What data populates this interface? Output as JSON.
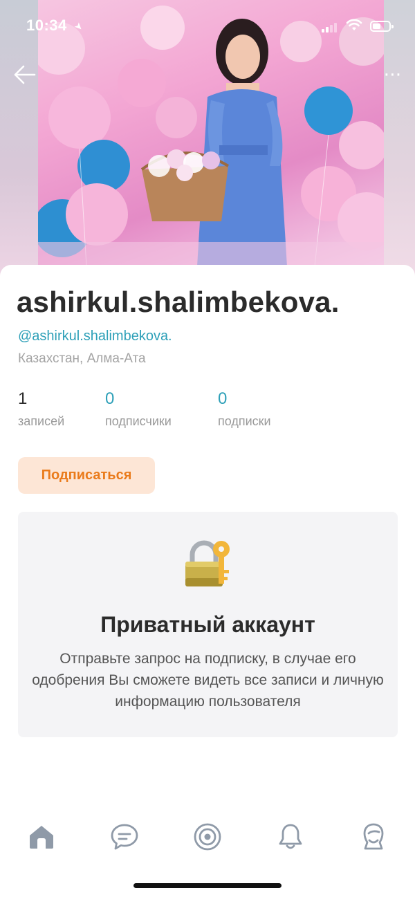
{
  "status_bar": {
    "time": "10:34"
  },
  "profile": {
    "username": "ashirkul.shalimbekova.",
    "handle": "@ashirkul.shalimbekova.",
    "location": "Казахстан, Алма-Ата",
    "stats": {
      "posts": {
        "value": "1",
        "label": "записей"
      },
      "followers": {
        "value": "0",
        "label": "подписчики"
      },
      "following": {
        "value": "0",
        "label": "подписки"
      }
    },
    "follow_label": "Подписаться"
  },
  "private_notice": {
    "title": "Приватный аккаунт",
    "description": "Отправьте запрос на подписку, в случае его одобрения Вы сможете видеть все записи и личную информацию пользователя"
  },
  "tabbar": {
    "items": [
      "home-icon",
      "chat-icon",
      "discover-icon",
      "bell-icon",
      "profile-icon"
    ]
  },
  "colors": {
    "handle": "#2ea0b8",
    "follow_bg": "#fde6d6",
    "follow_text": "#ea7b1b",
    "card_bg": "#f4f4f6",
    "tab_icon": "#8f9aa8"
  }
}
